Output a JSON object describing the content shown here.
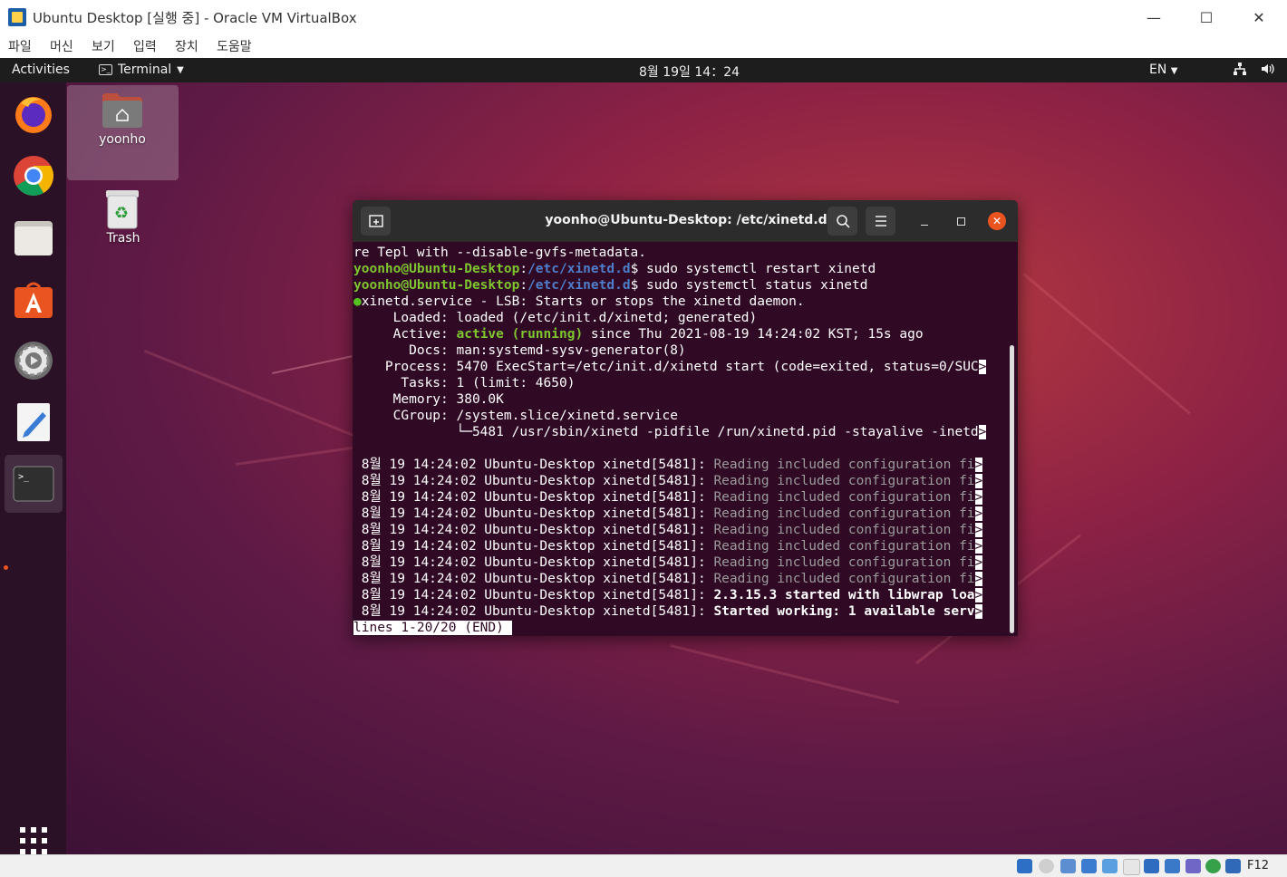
{
  "window": {
    "title": "Ubuntu Desktop [실행 중] - Oracle VM VirtualBox",
    "controls": {
      "minimize": "—",
      "maximize": "☐",
      "close": "✕"
    }
  },
  "vbox_menu": [
    "파일",
    "머신",
    "보기",
    "입력",
    "장치",
    "도움말"
  ],
  "topbar": {
    "activities": "Activities",
    "app_menu": "Terminal",
    "clock": "8월 19일  14：24",
    "language": "EN"
  },
  "dock": {
    "items": [
      "firefox-icon",
      "chrome-icon",
      "files-icon",
      "ubuntu-software-icon",
      "settings-icon",
      "text-editor-icon",
      "terminal-icon",
      "show-applications-icon"
    ]
  },
  "desktop_icons": {
    "home": "yoonho",
    "trash": "Trash"
  },
  "terminal": {
    "title": "yoonho@Ubuntu-Desktop: /etc/xinetd.d",
    "prompt_user": "yoonho@Ubuntu-Desktop",
    "prompt_path": "/etc/xinetd.d",
    "lines": {
      "l0": "re Tepl with --disable-gvfs-metadata.",
      "cmd1": "$ sudo systemctl restart xinetd",
      "cmd2": "$ sudo systemctl status xinetd",
      "service": "xinetd.service - LSB: Starts or stops the xinetd daemon.",
      "loaded_label": "     Loaded: ",
      "loaded_value": "loaded (/etc/init.d/xinetd; generated)",
      "active_label": "     Active: ",
      "active_state": "active (running)",
      "active_rest": " since Thu 2021-08-19 14:24:02 KST; 15s ago",
      "docs": "       Docs: man:systemd-sysv-generator(8)",
      "process": "    Process: 5470 ExecStart=/etc/init.d/xinetd start (code=exited, status=0/SUC",
      "tasks": "      Tasks: 1 (limit: 4650)",
      "memory": "     Memory: 380.0K",
      "cgroup": "     CGroup: /system.slice/xinetd.service",
      "cgroup_child": "             └─5481 /usr/sbin/xinetd -pidfile /run/xinetd.pid -stayalive -inetd",
      "log_prefix": " 8월 19 14:24:02 Ubuntu-Desktop xinetd[5481]: ",
      "log_reading": "Reading included configuration fi",
      "log_started": "2.3.15.3 started with libwrap loa",
      "log_working": "Started working: 1 available serv",
      "truncated": ">",
      "pager_status": "lines 1-20/20 (END)"
    }
  },
  "statusbar": {
    "host_key": "F12"
  }
}
